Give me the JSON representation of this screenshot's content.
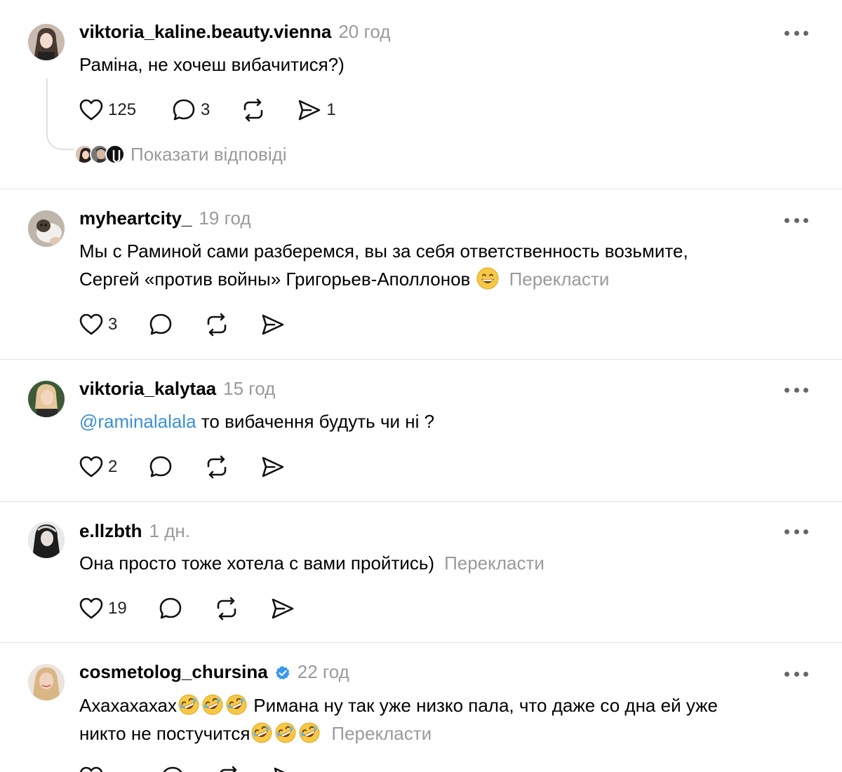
{
  "posts": [
    {
      "username": "viktoria_kaline.beauty.vienna",
      "time": "20 год",
      "text": "Раміна, не хочеш вибачитися?)",
      "likes": "125",
      "comments": "3",
      "shares": "1",
      "show_replies": "Показати відповіді"
    },
    {
      "username": "myheartcity_",
      "time": "19 год",
      "text_line1": "Мы с Раминой сами разберемся, вы за себя ответственность возьмите,",
      "text_line2": "Сергей «против войны» Григорьев-Аполлонов",
      "translate": "Перекласти",
      "likes": "3"
    },
    {
      "username": "viktoria_kalytaa",
      "time": "15 год",
      "mention": "@raminalalala",
      "text": " то вибачення будуть чи ні ?",
      "likes": "2"
    },
    {
      "username": "e.llzbth",
      "time": "1 дн.",
      "text": "Она просто тоже хотела с вами пройтись)",
      "translate": "Перекласти",
      "likes": "19"
    },
    {
      "username": "cosmetolog_chursina",
      "time": "22 год",
      "text_start": "Ахахахахах",
      "text_mid": " Римана ну так уже низко пала, что даже со дна ей уже",
      "text_line2": "никто не постучится",
      "translate": "Перекласти"
    }
  ],
  "colors": {
    "text": "#000000",
    "muted": "#9a9a9a",
    "mention": "#3b8fd6",
    "divider": "#e3e3e3",
    "verified": "#3897f0"
  },
  "icons": [
    "heart-icon",
    "comment-icon",
    "repost-icon",
    "share-icon",
    "more-icon",
    "verified-icon",
    "grinning-emoji",
    "rofl-emoji"
  ]
}
